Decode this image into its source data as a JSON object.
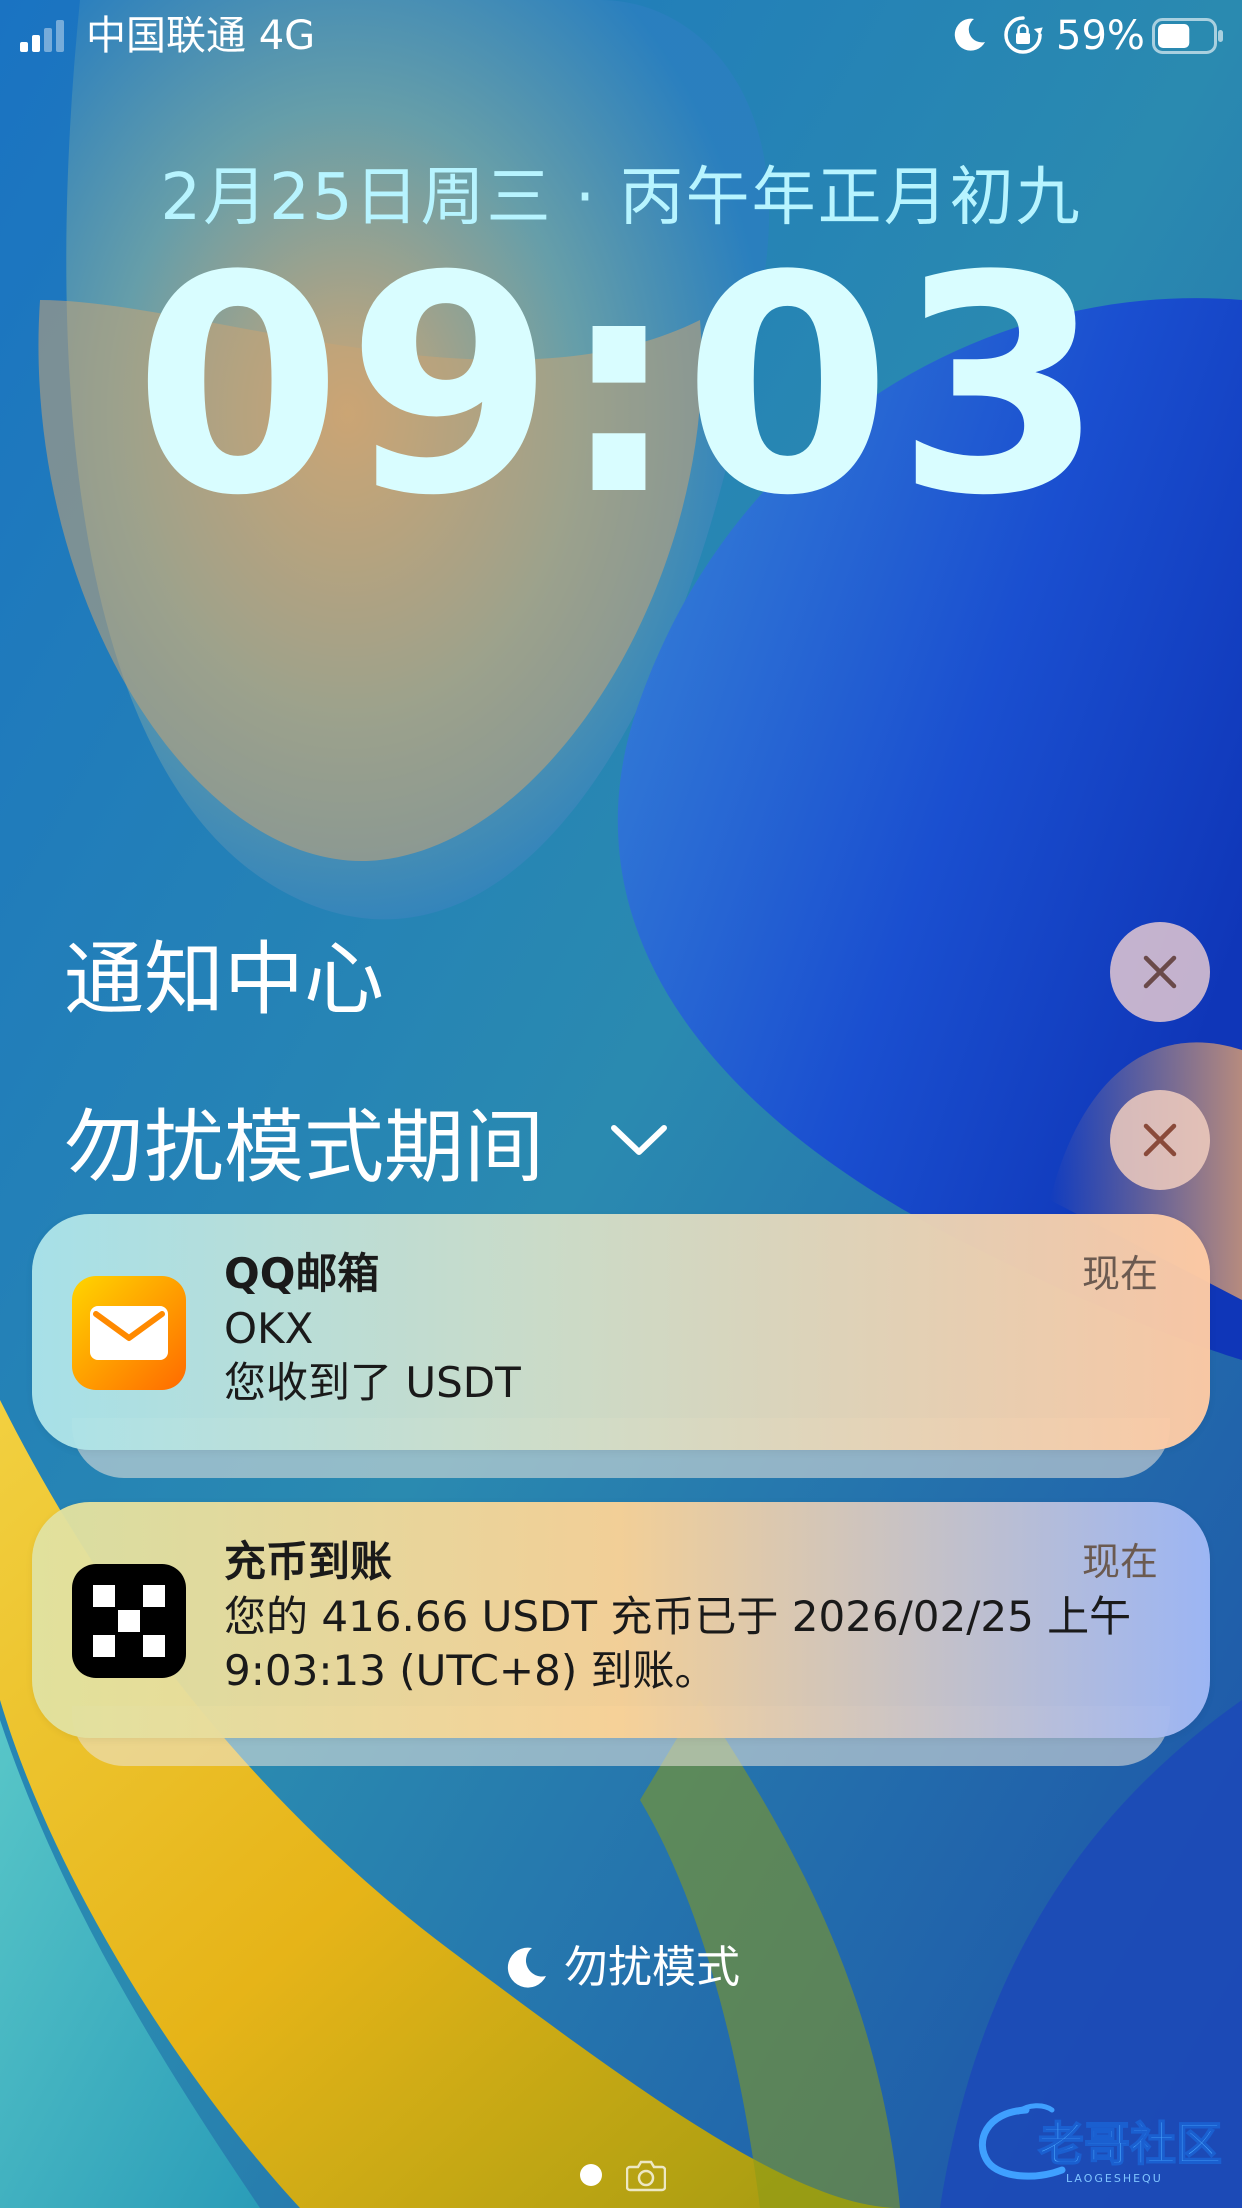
{
  "status_bar": {
    "carrier": "中国联通  4G",
    "battery_percent": "59%",
    "battery_level": 0.59,
    "icons": [
      "cellular-signal-icon",
      "moon-icon",
      "rotation-lock-icon",
      "battery-icon"
    ]
  },
  "lock_screen": {
    "date": "2月25日周三 · 丙午年正月初九",
    "time": "09:03"
  },
  "notification_center": {
    "title": "通知中心",
    "group_title": "勿扰模式期间",
    "icons": [
      "close-icon",
      "chevron-down-icon"
    ]
  },
  "notifications": [
    {
      "app": "QQ邮箱",
      "time": "现在",
      "lines": [
        "OKX",
        "您收到了 USDT"
      ],
      "icon": "mail-app-icon",
      "icon_colors": [
        "#ffd500",
        "#ff6a00"
      ]
    },
    {
      "app": "充币到账",
      "time": "现在",
      "lines": [
        "您的 416.66 USDT 充币已于 2026/02/25 上午",
        "9:03:13 (UTC+8) 到账。"
      ],
      "icon": "okx-app-icon",
      "icon_colors": [
        "#000000",
        "#ffffff"
      ]
    }
  ],
  "footer": {
    "dnd_label": "勿扰模式"
  },
  "watermark": {
    "text": "老哥社区",
    "subtext": "LAOGESHEQU"
  }
}
